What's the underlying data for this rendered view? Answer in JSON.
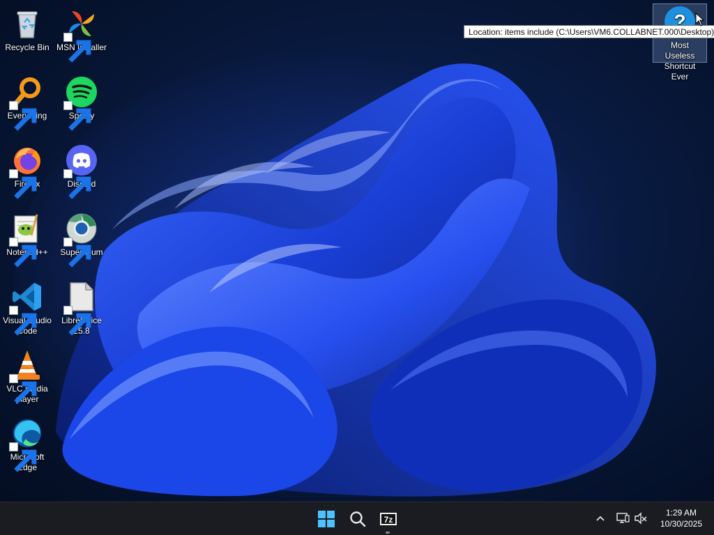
{
  "desktop": {
    "icons": [
      {
        "label": "Recycle Bin",
        "icon": "recycle-bin-icon"
      },
      {
        "label": "MSN Installer",
        "icon": "msn-icon"
      },
      {
        "label": "Everything",
        "icon": "everything-search-icon"
      },
      {
        "label": "Spotify",
        "icon": "spotify-icon"
      },
      {
        "label": "Firefox",
        "icon": "firefox-icon"
      },
      {
        "label": "Discord",
        "icon": "discord-icon"
      },
      {
        "label": "Notepad++",
        "icon": "notepad-plus-plus-icon"
      },
      {
        "label": "Supermium",
        "icon": "supermium-icon"
      },
      {
        "label": "Visual Studio Code",
        "icon": "vscode-icon"
      },
      {
        "label": "LibreOffice 25.8",
        "icon": "libreoffice-icon"
      },
      {
        "label": "VLC media player",
        "icon": "vlc-icon"
      },
      {
        "label": "Microsoft Edge",
        "icon": "edge-icon"
      },
      {
        "label": "Most Useless Shortcut Ever",
        "icon": "help-question-icon"
      }
    ]
  },
  "tooltip": {
    "text": "Location: items include (C:\\Users\\VM6.COLLABNET.000\\Desktop)"
  },
  "taskbar": {
    "start": "windows-start-icon",
    "search": "search-icon",
    "pinned": [
      "7zip-icon"
    ],
    "tray": [
      "chevron-up-icon",
      "network-icon",
      "volume-muted-icon"
    ]
  },
  "clock": {
    "time": "1:29 AM",
    "date": "10/30/2025"
  },
  "colors": {
    "taskbar": "#1b1c22",
    "wallpaper_accent": "#1f4dff",
    "tooltip_bg": "#ffffff"
  }
}
